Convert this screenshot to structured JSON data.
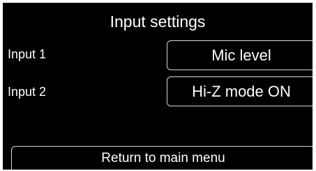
{
  "screen": {
    "title": "Input settings"
  },
  "inputs": [
    {
      "label": "Input 1",
      "value": "Mic level"
    },
    {
      "label": "Input 2",
      "value": "Hi-Z mode ON"
    }
  ],
  "footer": {
    "return_label": "Return to main menu"
  },
  "colors": {
    "background": "#000000",
    "text": "#ffffff",
    "button_border": "#d9d9d9"
  }
}
